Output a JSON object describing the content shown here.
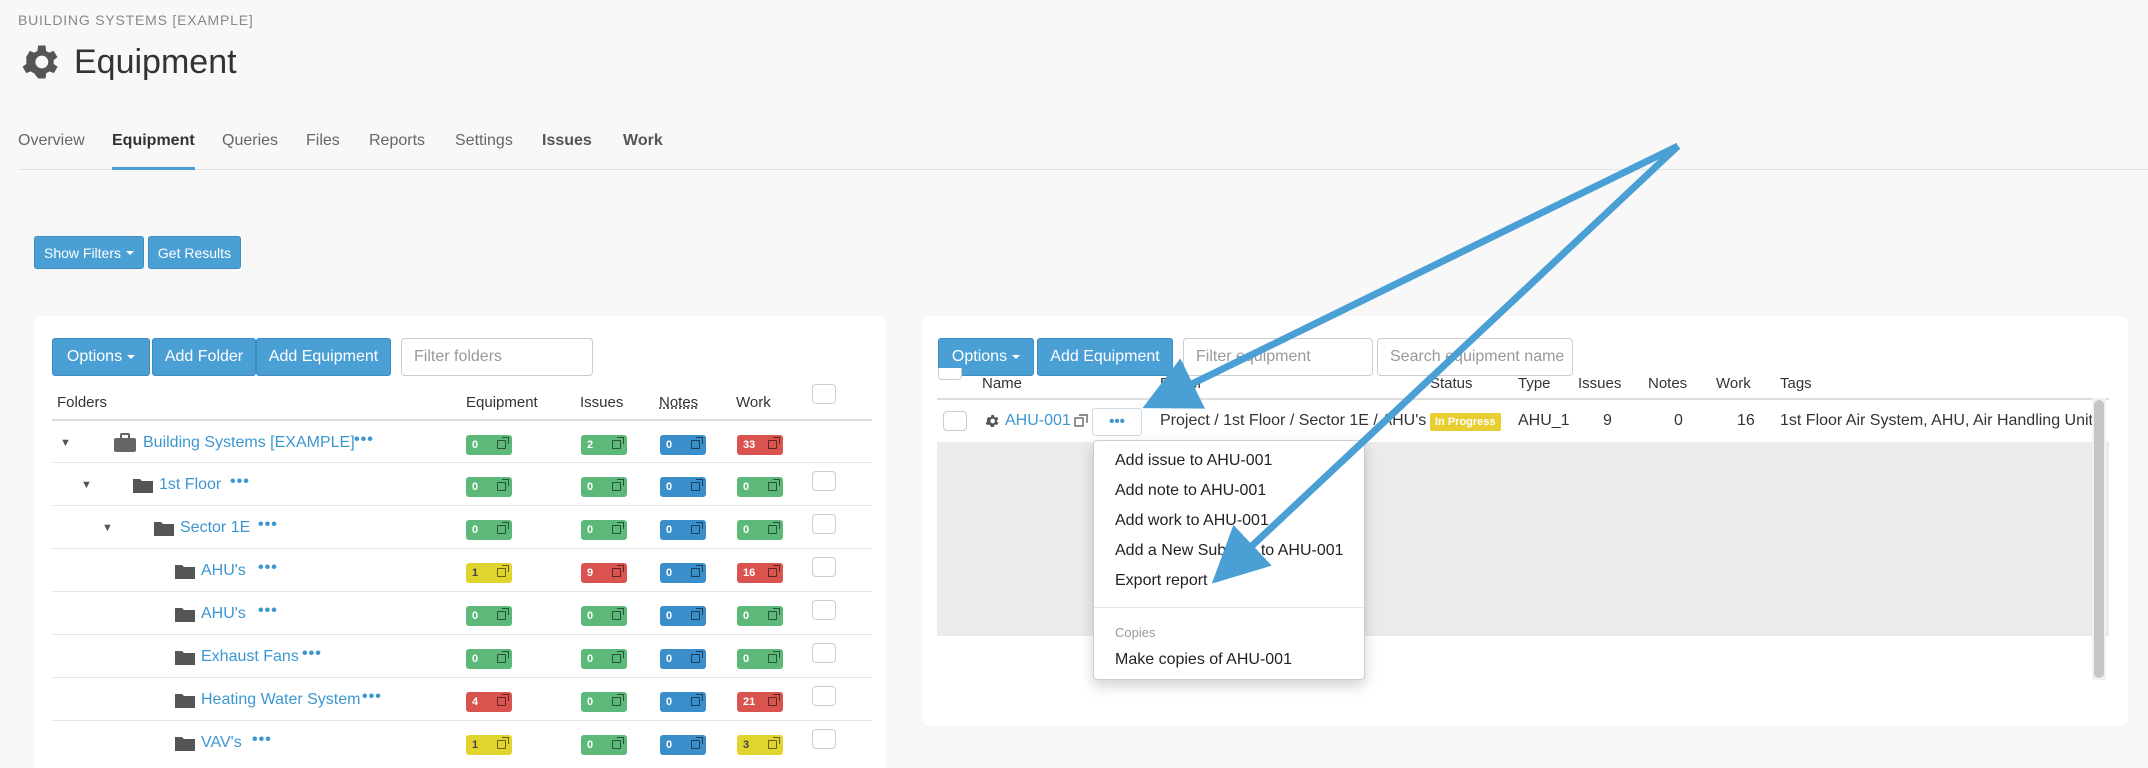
{
  "breadcrumb": "BUILDING SYSTEMS [EXAMPLE]",
  "title": "Equipment",
  "tabs": [
    "Overview",
    "Equipment",
    "Queries",
    "Files",
    "Reports",
    "Settings",
    "Issues",
    "Work"
  ],
  "filters": {
    "show_filters": "Show Filters",
    "get_results": "Get Results"
  },
  "left_panel": {
    "options": "Options",
    "add_folder": "Add Folder",
    "add_equipment": "Add Equipment",
    "filter_placeholder": "Filter folders",
    "headers": {
      "folders": "Folders",
      "equipment": "Equipment",
      "issues": "Issues",
      "notes": "Notes",
      "work": "Work"
    },
    "rows": [
      {
        "label": "Building Systems [EXAMPLE]",
        "equipment": "0",
        "issues": "2",
        "notes": "0",
        "work": "33"
      },
      {
        "label": "1st Floor",
        "equipment": "0",
        "issues": "0",
        "notes": "0",
        "work": "0"
      },
      {
        "label": "Sector 1E",
        "equipment": "0",
        "issues": "0",
        "notes": "0",
        "work": "0"
      },
      {
        "label": "AHU's",
        "equipment": "1",
        "issues": "9",
        "notes": "0",
        "work": "16"
      },
      {
        "label": "AHU's",
        "equipment": "0",
        "issues": "0",
        "notes": "0",
        "work": "0"
      },
      {
        "label": "Exhaust Fans",
        "equipment": "0",
        "issues": "0",
        "notes": "0",
        "work": "0"
      },
      {
        "label": "Heating Water System",
        "equipment": "4",
        "issues": "0",
        "notes": "0",
        "work": "21"
      },
      {
        "label": "VAV's",
        "equipment": "1",
        "issues": "0",
        "notes": "0",
        "work": "3"
      }
    ]
  },
  "right_panel": {
    "options": "Options",
    "add_equipment": "Add Equipment",
    "filter_placeholder": "Filter equipment",
    "search_placeholder": "Search equipment name",
    "headers": {
      "name": "Name",
      "folder": "Folder",
      "status": "Status",
      "type": "Type",
      "issues": "Issues",
      "notes": "Notes",
      "work": "Work",
      "tags": "Tags"
    },
    "row": {
      "name": "AHU-001",
      "folder": "Project / 1st Floor / Sector 1E / AHU's",
      "status": "In Progress",
      "type": "AHU_1",
      "issues": "9",
      "notes": "0",
      "work": "16",
      "tags": "1st Floor Air System, AHU, Air Handling Unit"
    }
  },
  "context_menu": {
    "items": [
      "Add issue to AHU-001",
      "Add note to AHU-001",
      "Add work to AHU-001",
      "Add a New Subitem to AHU-001",
      "Export report"
    ],
    "section_header": "Copies",
    "copies_item": "Make copies of AHU-001"
  },
  "colors": {
    "accent": "#4a9fd5",
    "green": "#5cb97a",
    "blue": "#3a8ec9",
    "red": "#d9534f",
    "yellow": "#e2d42f",
    "annotation_arrow": "#4a9fd5"
  }
}
